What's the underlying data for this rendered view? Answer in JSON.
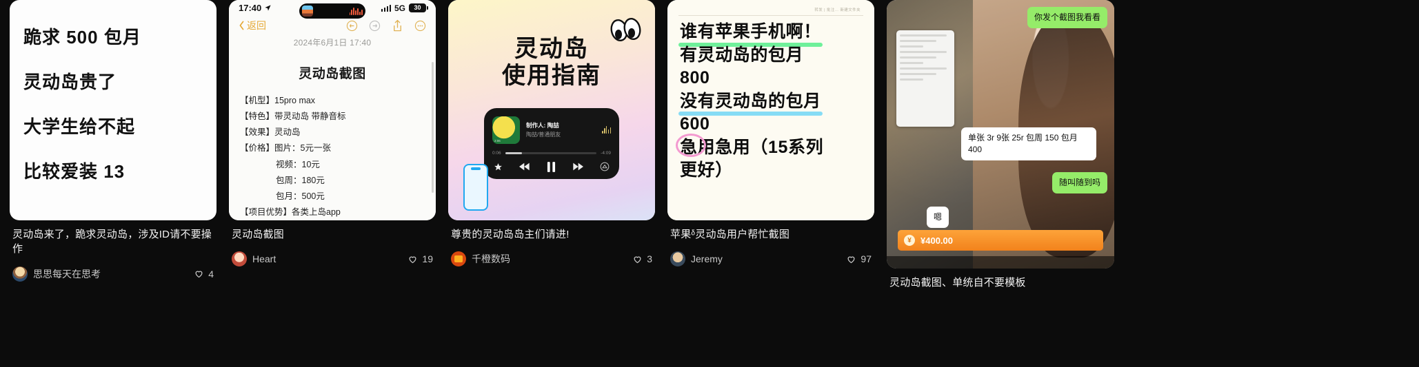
{
  "feed": {
    "cards": [
      {
        "id": "card-note-plea",
        "note_lines": [
          "跪求 500 包月",
          "灵动岛贵了",
          "大学生给不起",
          "比较爱装 13"
        ],
        "caption": "灵动岛来了，跪求灵动岛，涉及ID请不要操作",
        "author": "思思每天在思考",
        "likes": "4"
      },
      {
        "id": "card-ios-screenshot",
        "status": {
          "time": "17:40",
          "network": "5G",
          "battery": "30"
        },
        "nav": {
          "back": "返回"
        },
        "date": "2024年6月1日 17:40",
        "doc_title": "灵动岛截图",
        "spec_rows": [
          {
            "text": "【机型】15pro max",
            "indent": false
          },
          {
            "text": "【特色】带灵动岛 带静音标",
            "indent": false
          },
          {
            "text": "【效果】灵动岛",
            "indent": false
          },
          {
            "text": "【价格】图片：5元一张",
            "indent": false
          },
          {
            "text": "视频：10元",
            "indent": true
          },
          {
            "text": "包周：180元",
            "indent": true
          },
          {
            "text": "包月：500元",
            "indent": true
          },
          {
            "text": "【项目优势】各类上岛app",
            "indent": false
          }
        ],
        "caption": "灵动岛截图",
        "author": "Heart",
        "likes": "19"
      },
      {
        "id": "card-poster-guide",
        "poster_title_l1": "灵动岛",
        "poster_title_l2": "使用指南",
        "player": {
          "maker": "制作人: 陶喆",
          "sub": "陶喆/普通朋友",
          "elapsed": "0:06",
          "remaining": "-4:09"
        },
        "caption": "尊贵的灵动岛岛主们请进!",
        "author": "千橙数码",
        "likes": "3"
      },
      {
        "id": "card-note-ask",
        "header_note": "转发 | 批注… 新建文件夹",
        "lines": [
          {
            "text": "谁有苹果手机啊！",
            "highlight": "green"
          },
          {
            "text": "有灵动岛的包月",
            "highlight": "none"
          },
          {
            "text": "800",
            "highlight": "none"
          },
          {
            "text": "没有灵动岛的包月",
            "highlight": "blue"
          },
          {
            "text": "600",
            "highlight": "none"
          },
          {
            "text": "急用急用（15系列",
            "highlight": "circle"
          },
          {
            "text": "更好）",
            "highlight": "none"
          }
        ],
        "caption": "苹果ᵟ灵动岛用户帮忙截图",
        "author": "Jeremy",
        "likes": "97"
      },
      {
        "id": "card-chat-deal",
        "messages": [
          {
            "side": "me",
            "text": "你发个截图我看看"
          },
          {
            "side": "you",
            "text": "单张 3r 9张 25r 包周 150 包月 400"
          },
          {
            "side": "me",
            "text": "随叫随到吗"
          },
          {
            "side": "you",
            "text": "嗯"
          }
        ],
        "pay": {
          "symbol": "¥",
          "amount": "¥400.00",
          "coin": "¥"
        },
        "caption": "灵动岛截图、单统自不要模板"
      }
    ]
  }
}
